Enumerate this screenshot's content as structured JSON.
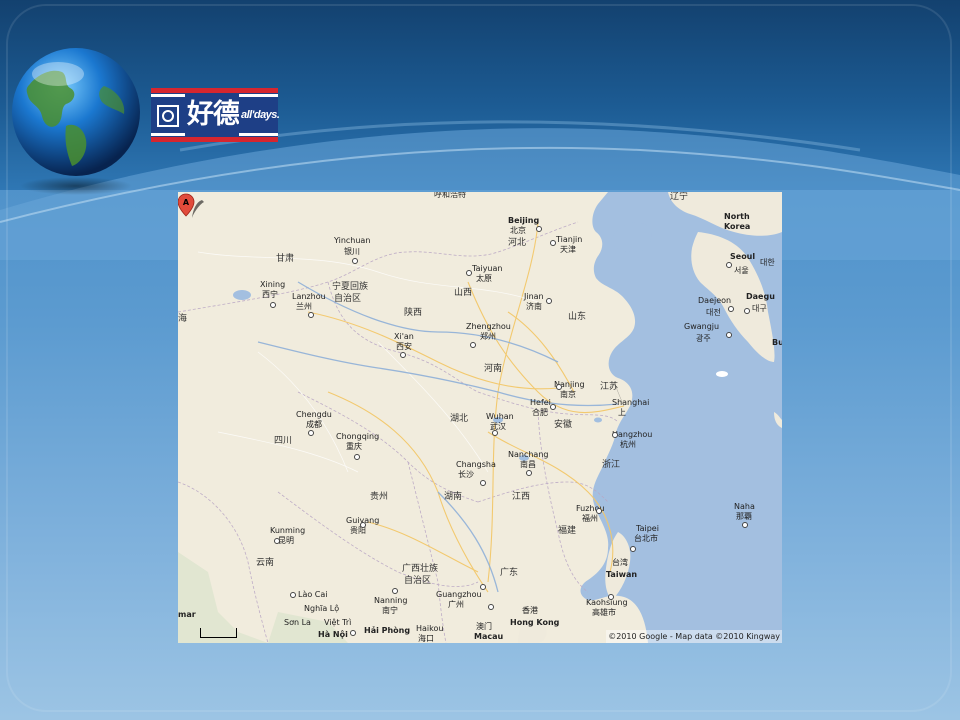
{
  "logo": {
    "brand_cn": "好德",
    "brand_en": "all'days."
  },
  "map": {
    "attribution": "©2010 Google - Map data ©2010 Kingway",
    "marker_label": "A",
    "labels": {
      "hohhot_partial": "呼和浩特",
      "beijing_en": "Beijing",
      "beijing_cn": "北京",
      "hebei": "河北",
      "tianjin_en": "Tianjin",
      "tianjin_cn": "天津",
      "liaoning": "辽宁",
      "north_korea": "North\nKorea",
      "seoul_en": "Seoul",
      "seoul_cn": "서울",
      "daejeon_partial": "대한",
      "daegu_en": "Daegu",
      "daegu_cn": "대구",
      "daejeon_en": "Daejeon",
      "daejeon_cn": "대전",
      "gwangju_en": "Gwangju",
      "gwangju_cn": "광주",
      "busan_partial": "Bu",
      "gansu": "甘肃",
      "yinchuan_en": "Yinchuan",
      "yinchuan_cn": "银川",
      "taiyuan_en": "Taiyuan",
      "taiyuan_cn": "太原",
      "shanxi": "山西",
      "jinan_en": "Jinan",
      "jinan_cn": "济南",
      "shandong": "山东",
      "xining_en": "Xining",
      "xining_cn": "西宁",
      "ningxia": "宁夏回族",
      "ningxia2": "自治区",
      "lanzhou_en": "Lanzhou",
      "lanzhou_cn": "兰州",
      "qinghai_partial": "海",
      "shaanxi": "陕西",
      "zhengzhou_en": "Zhengzhou",
      "zhengzhou_cn": "郑州",
      "xian_en": "Xi'an",
      "xian_cn": "西安",
      "henan": "河南",
      "nanjing_en": "Nanjing",
      "nanjing_cn": "南京",
      "jiangsu": "江苏",
      "hefei_en": "Hefei",
      "hefei_cn": "合肥",
      "shanghai_en": "Shanghai",
      "shanghai_cn": "上",
      "chengdu_en": "Chengdu",
      "chengdu_cn": "成都",
      "hubei": "湖北",
      "wuhan_en": "Wuhan",
      "wuhan_cn": "武汉",
      "anhui": "安徽",
      "hangzhou_en": "Hangzhou",
      "hangzhou_cn": "杭州",
      "sichuan": "四川",
      "chongqing_en": "Chongqing",
      "chongqing_cn": "重庆",
      "nanchang_en": "Nanchang",
      "nanchang_cn": "南昌",
      "zhejiang": "浙江",
      "changsha_en": "Changsha",
      "changsha_cn": "长沙",
      "guizhou": "贵州",
      "hunan": "湖南",
      "jiangxi": "江西",
      "fuzhou_en": "Fuzhou",
      "fuzhou_cn": "福州",
      "naha_en": "Naha",
      "naha_cn": "那覇",
      "guiyang_en": "Guiyang",
      "guiyang_cn": "贵阳",
      "fujian": "福建",
      "taipei_en": "Taipei",
      "taipei_cn": "台北市",
      "kunming_en": "Kunming",
      "kunming_cn": "昆明",
      "taiwan_cn": "台湾",
      "taiwan_en": "Taiwan",
      "yunnan": "云南",
      "guangxi": "广西壮族",
      "guangxi2": "自治区",
      "guangdong": "广东",
      "guangzhou_en": "Guangzhou",
      "guangzhou_cn": "广州",
      "kaohsiung_en": "Kaohsiung",
      "kaohsiung_cn": "高雄市",
      "laocai": "Lào Cai",
      "nanning_en": "Nanning",
      "nanning_cn": "南宁",
      "hongkong_cn": "香港",
      "hongkong_en": "Hong Kong",
      "myanmar_partial": "mar",
      "nghialo": "Nghĩa Lộ",
      "sonla": "Sơn La",
      "viettri": "Việt Trì",
      "hanoi": "Hà Nội",
      "haiphong": "Hải Phòng",
      "haikou_en": "Haikou",
      "haikou_cn": "海口",
      "macau_cn": "澳门",
      "macau_en": "Macau"
    }
  }
}
